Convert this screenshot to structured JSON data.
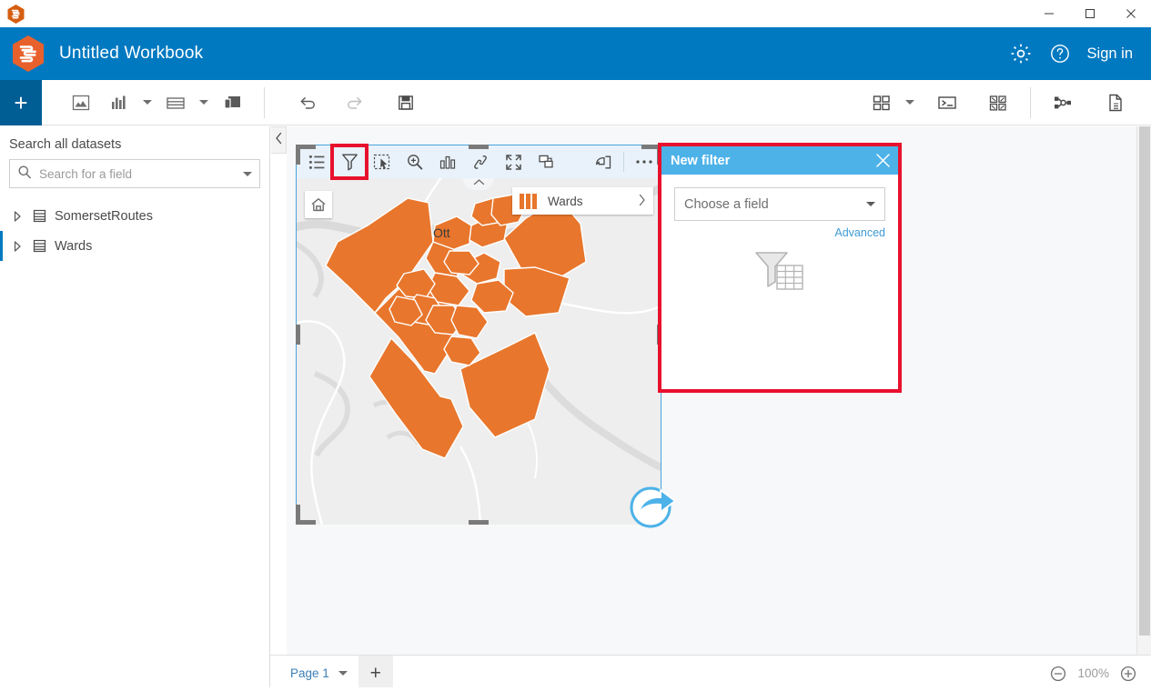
{
  "window": {
    "app_icon": "insights-hex-icon",
    "minimize_label": "Minimize",
    "maximize_label": "Maximize",
    "close_label": "Close"
  },
  "appbar": {
    "title": "Untitled Workbook",
    "logo_icon": "insights-hex-icon",
    "settings_icon": "gear-icon",
    "help_icon": "help-circle-icon",
    "signin_label": "Sign in"
  },
  "toolbar": {
    "add_label": "+",
    "items": [
      {
        "name": "map-icon",
        "label": "Map"
      },
      {
        "name": "chart-bar-icon",
        "label": "Chart"
      },
      {
        "name": "table-icon",
        "label": "Table"
      },
      {
        "name": "cards-icon",
        "label": "Cards"
      },
      {
        "name": "undo-icon",
        "label": "Undo"
      },
      {
        "name": "redo-icon",
        "label": "Redo"
      },
      {
        "name": "save-icon",
        "label": "Save"
      },
      {
        "name": "layout-grid-icon",
        "label": "Page layout"
      },
      {
        "name": "console-icon",
        "label": "Scripting console"
      },
      {
        "name": "widgets-icon",
        "label": "Widgets"
      },
      {
        "name": "analysis-model-icon",
        "label": "Analysis view"
      },
      {
        "name": "report-page-icon",
        "label": "Report"
      }
    ]
  },
  "sidebar": {
    "heading": "Search all datasets",
    "search_placeholder": "Search for a field",
    "search_value": "",
    "search_icon": "search-icon",
    "dropdown_icon": "chevron-down-icon",
    "datasets": [
      {
        "label": "SomersetRoutes",
        "icon": "table-dataset-icon",
        "expand_icon": "triangle-right-icon",
        "active": false
      },
      {
        "label": "Wards",
        "icon": "table-dataset-icon",
        "expand_icon": "triangle-right-icon",
        "active": true
      }
    ],
    "collapse_icon": "chevron-left-icon"
  },
  "card": {
    "toolbar_items": [
      {
        "name": "legend-icon",
        "label": "Legend",
        "highlighted": false
      },
      {
        "name": "filter-icon",
        "label": "Filter",
        "highlighted": true
      },
      {
        "name": "selection-tool-icon",
        "label": "Selection tools",
        "highlighted": false
      },
      {
        "name": "zoom-to-icon",
        "label": "Zoom to",
        "highlighted": false
      },
      {
        "name": "visualization-type-icon",
        "label": "Visualization type",
        "highlighted": false
      },
      {
        "name": "link-icon",
        "label": "Enable cross filters",
        "highlighted": false
      },
      {
        "name": "maximize-icon",
        "label": "Maximize",
        "highlighted": false
      },
      {
        "name": "layers-icon",
        "label": "Flip card",
        "highlighted": false
      },
      {
        "name": "export-icon",
        "label": "Export",
        "highlighted": false
      },
      {
        "name": "more-options-icon",
        "label": "More",
        "highlighted": false
      }
    ],
    "home_icon": "home-icon",
    "legend": {
      "label": "Wards",
      "swatch_color": "#e8762c",
      "expand_icon": "chevron-right-icon"
    },
    "map_place_label": "Ott",
    "collapse_icon": "chevron-up-icon",
    "cursor_icon": "pointer-share-cursor-icon"
  },
  "filter_panel": {
    "title": "New filter",
    "close_icon": "close-icon",
    "field_select_value": "Choose a field",
    "field_select_icon": "chevron-down-icon",
    "advanced_label": "Advanced",
    "graphic_icon": "filter-table-icon",
    "highlight_color": "#e8112d",
    "header_color": "#4db2e8"
  },
  "bottom": {
    "page_label": "Page 1",
    "page_menu_icon": "chevron-down-icon",
    "add_page_label": "+",
    "zoom_out_icon": "minus-circle-icon",
    "zoom_value": "100%",
    "zoom_in_icon": "plus-circle-icon"
  },
  "colors": {
    "brand_blue": "#0079c1",
    "accent_orange": "#e8762c",
    "highlight_red": "#e8112d",
    "card_border": "#4aa3dd"
  }
}
